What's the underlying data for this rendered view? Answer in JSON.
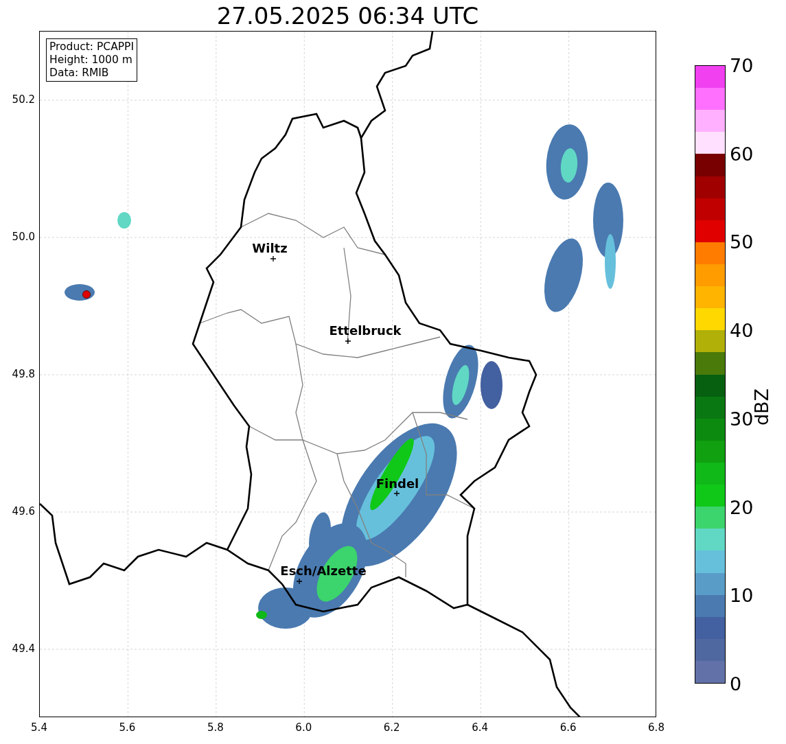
{
  "title": "27.05.2025 06:34 UTC",
  "info_box": [
    "Product: PCAPPI",
    "Height: 1000 m",
    "Data: RMIB"
  ],
  "places": [
    {
      "name": "Wiltz"
    },
    {
      "name": "Ettelbruck"
    },
    {
      "name": "Findel"
    },
    {
      "name": "Esch/Alzette"
    }
  ],
  "x_ticks": [
    "5.4",
    "5.6",
    "5.8",
    "6.0",
    "6.2",
    "6.4",
    "6.6",
    "6.8"
  ],
  "y_ticks": [
    "50.2",
    "50.0",
    "49.8",
    "49.6",
    "49.4"
  ],
  "colorbar": {
    "label": "dBZ",
    "ticks": [
      "70",
      "60",
      "50",
      "40",
      "30",
      "20",
      "10",
      "0"
    ],
    "bins": [
      {
        "color": "#f040f0"
      },
      {
        "color": "#ff70ff"
      },
      {
        "color": "#ffb0ff"
      },
      {
        "color": "#ffe0ff"
      },
      {
        "color": "#780000"
      },
      {
        "color": "#a00000"
      },
      {
        "color": "#c00000"
      },
      {
        "color": "#e00000"
      },
      {
        "color": "#ff7c00"
      },
      {
        "color": "#ff9c00"
      },
      {
        "color": "#ffb400"
      },
      {
        "color": "#ffd800"
      },
      {
        "color": "#b0b008"
      },
      {
        "color": "#4a7a0a"
      },
      {
        "color": "#066010"
      },
      {
        "color": "#0a7812"
      },
      {
        "color": "#0c8a10"
      },
      {
        "color": "#10a010"
      },
      {
        "color": "#10b818"
      },
      {
        "color": "#10c818"
      },
      {
        "color": "#3cd46c"
      },
      {
        "color": "#60d8c4"
      },
      {
        "color": "#66c0dc"
      },
      {
        "color": "#5a9cc8"
      },
      {
        "color": "#4a7ab0"
      },
      {
        "color": "#4360a0"
      },
      {
        "color": "#5068a0"
      },
      {
        "color": "#6272a8"
      }
    ]
  }
}
